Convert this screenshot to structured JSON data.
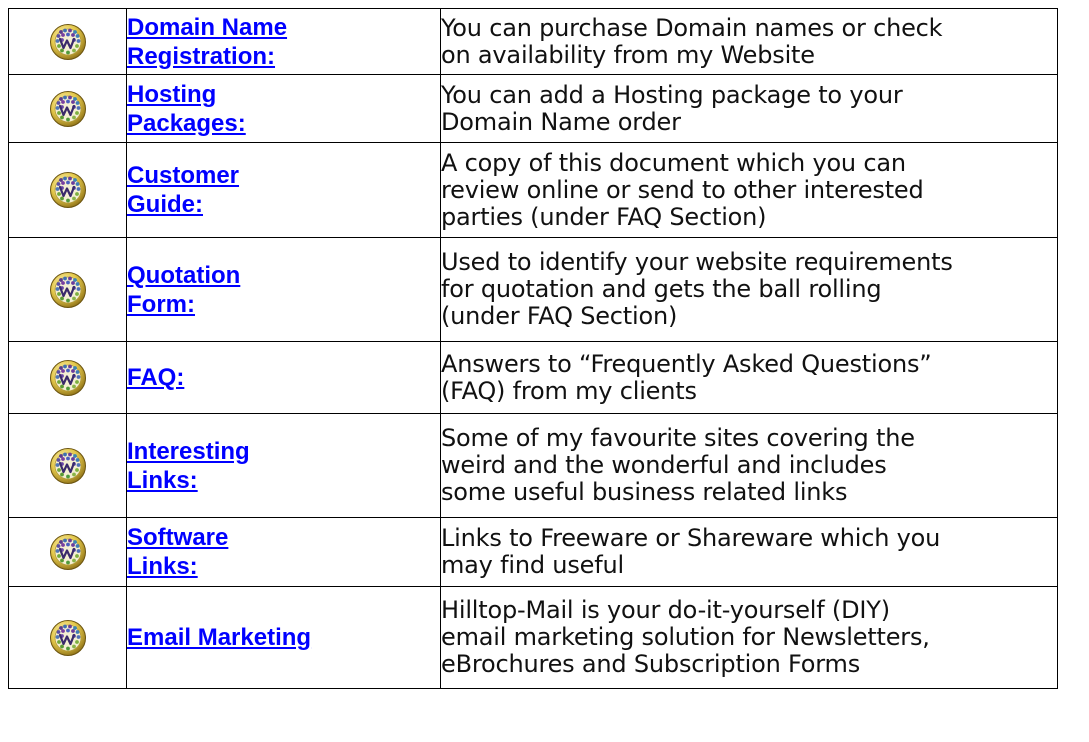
{
  "rows": [
    {
      "link": "Domain Name\nRegistration:",
      "desc": "You can purchase Domain names or check\non availability from my Website"
    },
    {
      "link": "Hosting\nPackages:",
      "desc": "You can add a Hosting package to your\nDomain Name order"
    },
    {
      "link": "Customer\nGuide:",
      "desc": "A copy of this document which you can\nreview online or send to other  interested\nparties (under FAQ Section)"
    },
    {
      "link": "Quotation\nForm:",
      "desc": "Used to identify your website requirements\nfor quotation and gets the ball rolling\n(under FAQ Section)"
    },
    {
      "link": "FAQ:",
      "desc": "Answers to “Frequently Asked  Questions”\n(FAQ) from my clients"
    },
    {
      "link": "Interesting\nLinks:",
      "desc": "Some of my favourite sites covering the\nweird and the wonderful and includes\nsome useful business related links"
    },
    {
      "link": "Software\nLinks:",
      "desc": "Links to Freeware or Shareware which you\nmay find useful"
    },
    {
      "link": "Email Marketing",
      "desc": "Hilltop-Mail is your do-it-yourself (DIY)\nemail marketing solution for Newsletters,\neBrochures and Subscription Forms"
    }
  ],
  "colors": {
    "link": "#0000ff",
    "text": "#111111",
    "border": "#000000"
  },
  "icon": "globe-logo-icon"
}
